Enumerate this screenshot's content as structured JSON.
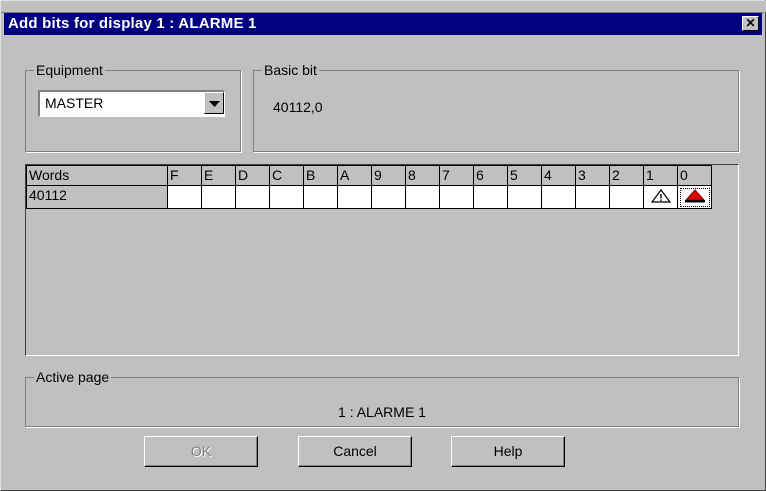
{
  "dialog": {
    "title": "Add bits for display 1 : ALARME 1",
    "close_label": "✕"
  },
  "equipment": {
    "label": "Equipment",
    "selected": "MASTER"
  },
  "basic_bit": {
    "label": "Basic bit",
    "value": "40112,0"
  },
  "grid": {
    "header_label": "Words",
    "bit_columns": [
      "F",
      "E",
      "D",
      "C",
      "B",
      "A",
      "9",
      "8",
      "7",
      "6",
      "5",
      "4",
      "3",
      "2",
      "1",
      "0"
    ],
    "rows": [
      {
        "word": "40112",
        "bit_1": "warning-outline-icon",
        "bit_0": "alarm-red-icon"
      }
    ]
  },
  "active_page": {
    "label": "Active page",
    "value": "1 : ALARME 1"
  },
  "buttons": {
    "ok": "OK",
    "cancel": "Cancel",
    "help": "Help"
  }
}
